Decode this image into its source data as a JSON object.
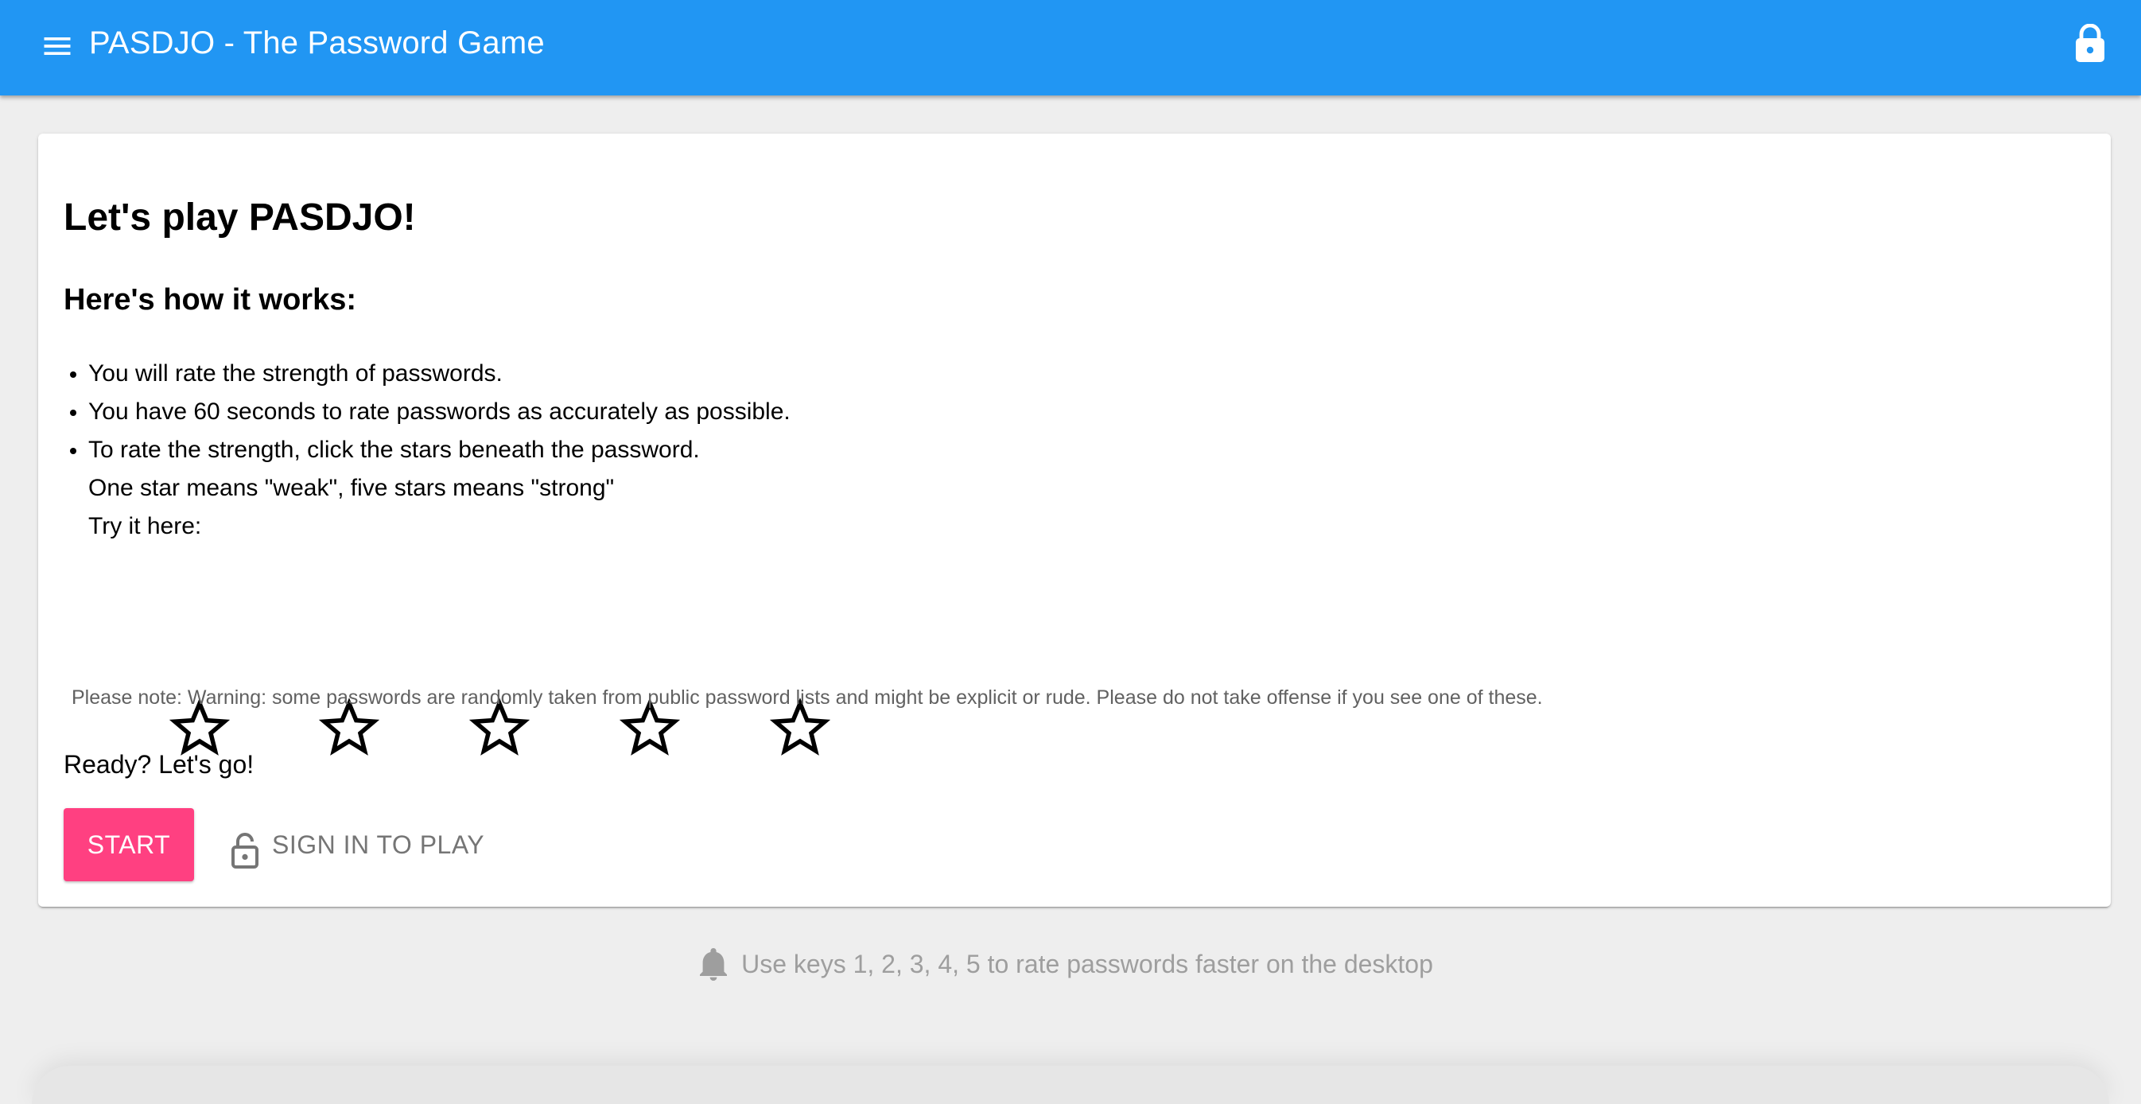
{
  "app": {
    "title": "PASDJO - The Password Game",
    "menu_icon": "menu-icon",
    "lock_icon": "lock-icon",
    "primary_color": "#2196f3",
    "accent_color": "#ff4081"
  },
  "intro": {
    "heading": "Let's play PASDJO!",
    "subheading": "Here's how it works:",
    "rules": [
      "You will rate the strength of passwords.",
      "You have 60 seconds to rate passwords as accurately as possible.",
      "To rate the strength, click the stars beneath the password."
    ],
    "rule_extra": [
      "One star means \"weak\", five stars means \"strong\"",
      "Try it here:"
    ],
    "rating": {
      "max": 5,
      "value": 0,
      "icon": "star-outline-icon"
    },
    "note": "Please note: Warning: some passwords are randomly taken from public password lists and might be explicit or rude. Please do not take offense if you see one of these.",
    "ready": "Ready? Let's go!"
  },
  "actions": {
    "start_label": "START",
    "signin_label": "SIGN IN TO PLAY",
    "signin_icon": "lock-open-icon"
  },
  "footer": {
    "hint_icon": "bell-icon",
    "hint": "Use keys 1, 2, 3, 4, 5 to rate passwords faster on the desktop"
  }
}
